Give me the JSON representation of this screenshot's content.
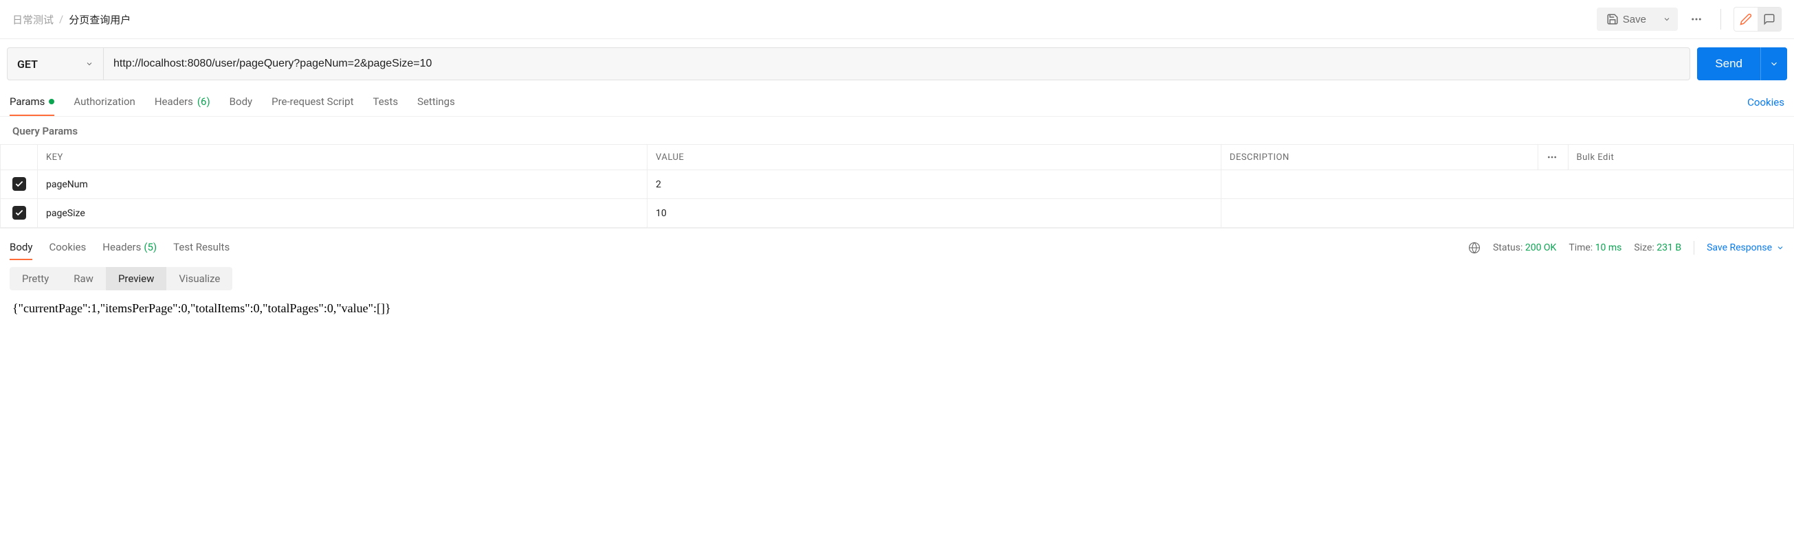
{
  "breadcrumb": {
    "parent": "日常测试",
    "current": "分页查询用户"
  },
  "header": {
    "save_label": "Save"
  },
  "request": {
    "method": "GET",
    "url": "http://localhost:8080/user/pageQuery?pageNum=2&pageSize=10",
    "send_label": "Send"
  },
  "tabs": {
    "params": "Params",
    "authorization": "Authorization",
    "headers": "Headers",
    "headers_count": "(6)",
    "body": "Body",
    "prerequest": "Pre-request Script",
    "tests": "Tests",
    "settings": "Settings",
    "cookies_link": "Cookies"
  },
  "params_section": {
    "title": "Query Params",
    "columns": {
      "key": "KEY",
      "value": "VALUE",
      "description": "DESCRIPTION",
      "bulk_edit": "Bulk Edit"
    },
    "rows": [
      {
        "checked": true,
        "key": "pageNum",
        "value": "2",
        "description": ""
      },
      {
        "checked": true,
        "key": "pageSize",
        "value": "10",
        "description": ""
      }
    ]
  },
  "response_tabs": {
    "body": "Body",
    "cookies": "Cookies",
    "headers": "Headers",
    "headers_count": "(5)",
    "test_results": "Test Results"
  },
  "response_meta": {
    "status_label": "Status:",
    "status_value": "200 OK",
    "time_label": "Time:",
    "time_value": "10 ms",
    "size_label": "Size:",
    "size_value": "231 B",
    "save_response": "Save Response"
  },
  "view_modes": {
    "pretty": "Pretty",
    "raw": "Raw",
    "preview": "Preview",
    "visualize": "Visualize"
  },
  "response_body": "{\"currentPage\":1,\"itemsPerPage\":0,\"totalItems\":0,\"totalPages\":0,\"value\":[]}"
}
